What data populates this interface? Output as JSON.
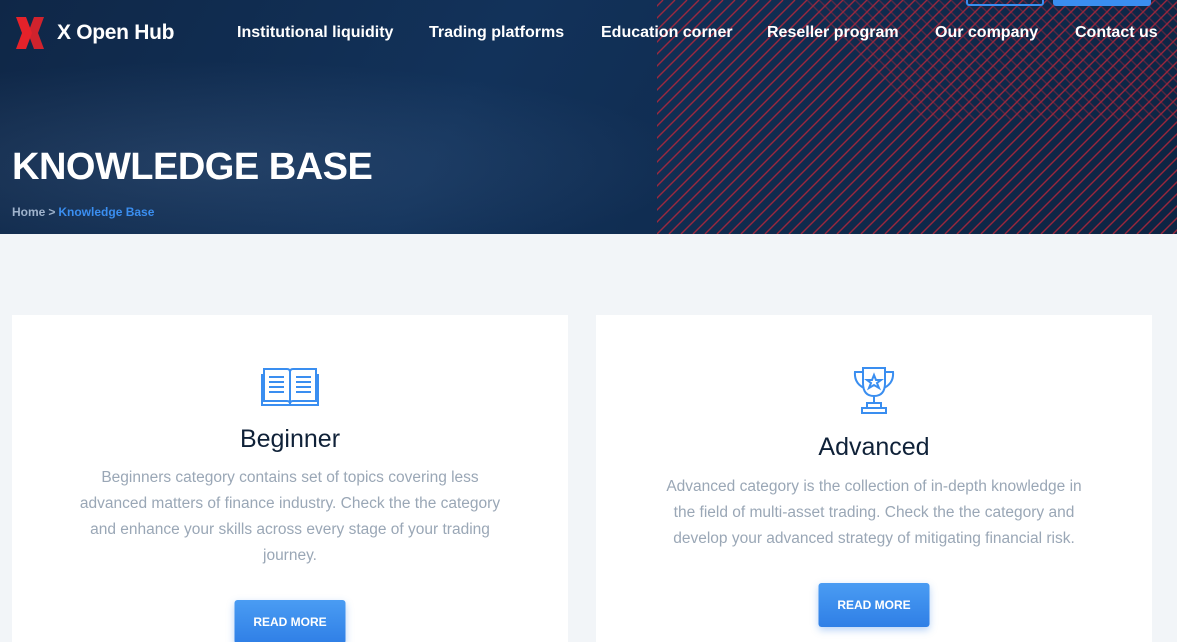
{
  "brand": {
    "name": "X Open Hub",
    "logo_icon": "x-logo-icon",
    "accent_red": "#e5222a"
  },
  "nav": [
    {
      "label": "Institutional liquidity"
    },
    {
      "label": "Trading platforms"
    },
    {
      "label": "Education corner"
    },
    {
      "label": "Reseller program"
    },
    {
      "label": "Our company"
    },
    {
      "label": "Contact us"
    }
  ],
  "hero": {
    "title": "KNOWLEDGE BASE",
    "breadcrumb": {
      "home": "Home",
      "separator": ">",
      "current": "Knowledge Base"
    }
  },
  "cards": [
    {
      "icon": "open-book-icon",
      "title": "Beginner",
      "description": "Beginners category contains set of topics covering less advanced matters of finance industry. Check the the category and enhance your skills across every stage of your trading journey.",
      "button": "READ MORE"
    },
    {
      "icon": "trophy-icon",
      "title": "Advanced",
      "description": "Advanced category is the collection of in-depth knowledge in the field of multi-asset trading. Check the the category and develop your advanced strategy of mitigating financial risk.",
      "button": "READ MORE"
    }
  ],
  "colors": {
    "accent": "#3a8ef0",
    "hero_bg": "#0f2747",
    "text_dark": "#0f2138",
    "text_muted": "#9aa7b6"
  }
}
